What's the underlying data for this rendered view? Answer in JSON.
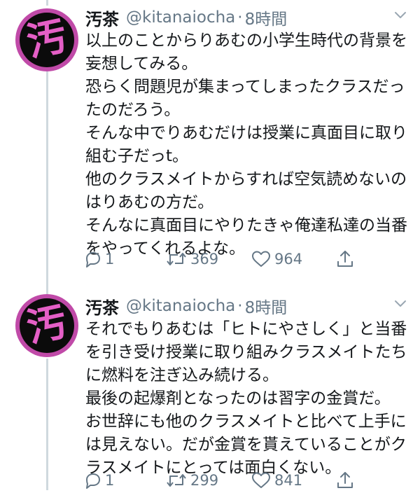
{
  "tweets": [
    {
      "display_name": "汚茶",
      "handle": "@kitanaiocha",
      "separator": "·",
      "timestamp": "8時間",
      "avatar_glyph": "汚",
      "body_lines": [
        "以上のことからりあむの小学生時代の背景を",
        "妄想してみる。",
        "恐らく問題児が集まってしまったクラスだっ",
        "たのだろう。",
        "そんな中でりあむだけは授業に真面目に取り",
        "組む子だっt。",
        "他のクラスメイトからすれば空気読めないの",
        "はりあむの方だ。",
        "そんなに真面目にやりたきゃ俺達私達の当番",
        "をやってくれるよな。"
      ],
      "replies": "1",
      "retweets": "369",
      "likes": "964"
    },
    {
      "display_name": "汚茶",
      "handle": "@kitanaiocha",
      "separator": "·",
      "timestamp": "8時間",
      "avatar_glyph": "汚",
      "body_lines": [
        "それでもりあむは「ヒトにやさしく」と当番",
        "を引き受け授業に取り組みクラスメイトたち",
        "に燃料を注ぎ込み続ける。",
        "最後の起爆剤となったのは習字の金賞だ。",
        "お世辞にも他のクラスメイトと比べて上手に",
        "は見えない。だが金賞を貰えていることがク",
        "ラスメイトにとっては面白くない。"
      ],
      "replies": "1",
      "retweets": "299",
      "likes": "841"
    }
  ],
  "icons": {
    "reply": "reply-icon",
    "retweet": "retweet-icon",
    "like": "heart-icon",
    "share": "share-icon",
    "more": "chevron-down-icon"
  },
  "colors": {
    "avatar_ring": "#c04aa8",
    "avatar_bg": "#0b0b0b",
    "avatar_glyph": "#e45fc6",
    "thread_line": "#cfd9de",
    "secondary_text": "#657786"
  }
}
